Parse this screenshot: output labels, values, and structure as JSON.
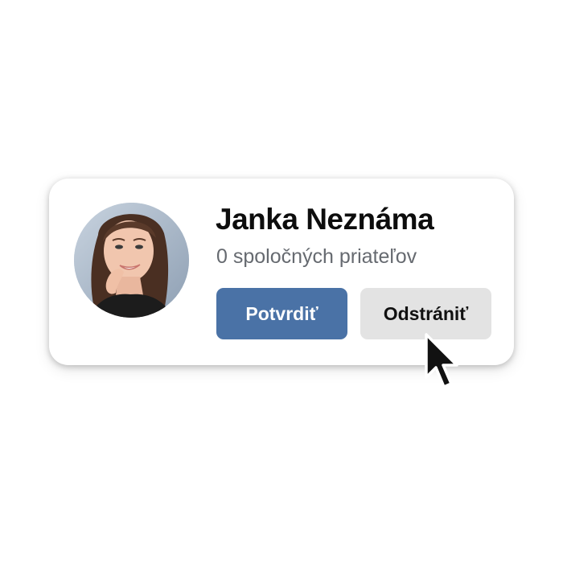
{
  "friend_request": {
    "name": "Janka Neznáma",
    "mutual_friends": "0 spoločných priateľov",
    "confirm_label": "Potvrdiť",
    "remove_label": "Odstrániť"
  },
  "colors": {
    "confirm_button": "#4a72a6",
    "remove_button": "#e3e3e3",
    "name_text": "#0d0d0d",
    "secondary_text": "#666a70"
  },
  "icons": {
    "cursor": "mouse-pointer-arrow"
  }
}
